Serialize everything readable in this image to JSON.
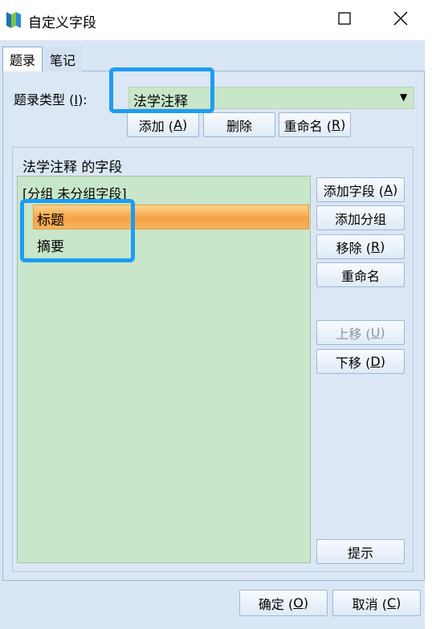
{
  "window": {
    "title": "自定义字段"
  },
  "tabs": [
    {
      "label": "题录",
      "active": true
    },
    {
      "label": "笔记",
      "active": false
    }
  ],
  "type_section": {
    "label": "题录类型 (",
    "label_key": "I",
    "label_end": "):",
    "selected_value": "法学注释",
    "buttons": {
      "add": {
        "label": "添加 (",
        "key": "A",
        "end": ")"
      },
      "delete": {
        "label": "删除"
      },
      "rename": {
        "label": "重命名 (",
        "key": "R",
        "end": ")"
      }
    }
  },
  "fields_group": {
    "title": "法学注释 的字段",
    "group_header": "[分组 未分组字段]",
    "items": [
      {
        "label": "标题",
        "selected": true
      },
      {
        "label": "摘要",
        "selected": false
      }
    ]
  },
  "side_buttons": {
    "add_field": {
      "label": "添加字段 (",
      "key": "A",
      "end": ")"
    },
    "add_group": {
      "label": "添加分组"
    },
    "remove": {
      "label": "移除 (",
      "key": "R",
      "end": ")"
    },
    "rename": {
      "label": "重命名"
    },
    "move_up": {
      "label": "上移 (",
      "key": "U",
      "end": ")",
      "enabled": false
    },
    "move_down": {
      "label": "下移 (",
      "key": "D",
      "end": ")",
      "enabled": true
    },
    "hint": {
      "label": "提示"
    }
  },
  "footer": {
    "ok": {
      "label": "确定 (",
      "key": "O",
      "end": ")"
    },
    "cancel": {
      "label": "取消 (",
      "key": "C",
      "end": ")"
    }
  },
  "colors": {
    "client_bg": "#d9e6f5",
    "list_bg": "#c8e6c9",
    "selection": "#f6a243",
    "highlight": "#1e9bf0"
  }
}
